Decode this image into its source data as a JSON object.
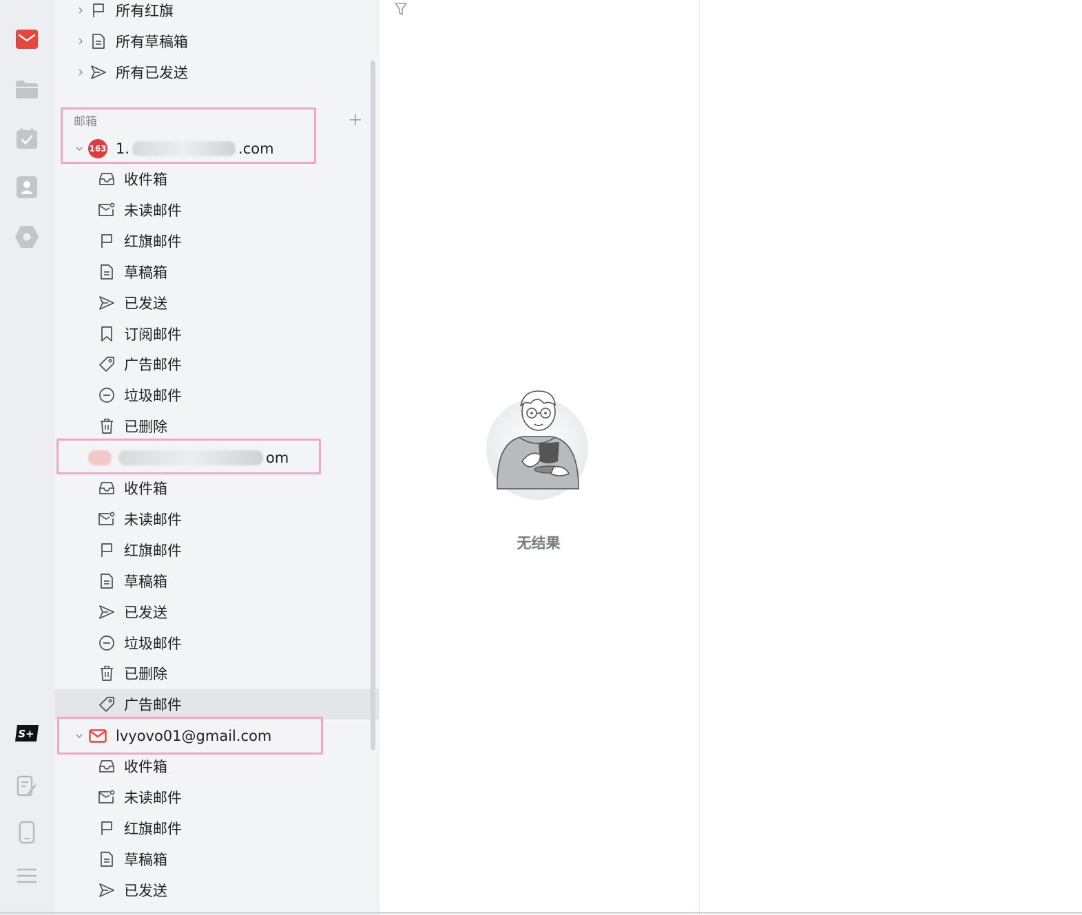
{
  "rail": {
    "top_icons": [
      "mail-icon",
      "folder-icon",
      "calendar-icon",
      "contacts-icon",
      "settings-hex-icon"
    ],
    "bottom_icons": [
      "splus-icon",
      "notes-icon",
      "mobile-icon",
      "menu-icon"
    ],
    "splus_label": "S+"
  },
  "aggregate": {
    "items": [
      {
        "label": "所有红旗",
        "icon": "flag-icon"
      },
      {
        "label": "所有草稿箱",
        "icon": "draft-icon"
      },
      {
        "label": "所有已发送",
        "icon": "send-icon"
      }
    ]
  },
  "mailboxes": {
    "section_label": "邮箱",
    "accounts": [
      {
        "address_prefix": "1.",
        "address_suffix": ".com",
        "badge": "163",
        "folders": [
          {
            "label": "收件箱",
            "icon": "inbox-icon"
          },
          {
            "label": "未读邮件",
            "icon": "unread-icon"
          },
          {
            "label": "红旗邮件",
            "icon": "flag-icon"
          },
          {
            "label": "草稿箱",
            "icon": "draft-icon"
          },
          {
            "label": "已发送",
            "icon": "send-icon"
          },
          {
            "label": "订阅邮件",
            "icon": "bookmark-icon"
          },
          {
            "label": "广告邮件",
            "icon": "tag-icon"
          },
          {
            "label": "垃圾邮件",
            "icon": "spam-icon"
          },
          {
            "label": "已删除",
            "icon": "trash-icon"
          }
        ]
      },
      {
        "address_prefix": "",
        "address_suffix": "om",
        "folders": [
          {
            "label": "收件箱",
            "icon": "inbox-icon"
          },
          {
            "label": "未读邮件",
            "icon": "unread-icon"
          },
          {
            "label": "红旗邮件",
            "icon": "flag-icon"
          },
          {
            "label": "草稿箱",
            "icon": "draft-icon"
          },
          {
            "label": "已发送",
            "icon": "send-icon"
          },
          {
            "label": "垃圾邮件",
            "icon": "spam-icon"
          },
          {
            "label": "已删除",
            "icon": "trash-icon"
          },
          {
            "label": "广告邮件",
            "icon": "tag-icon",
            "selected": true
          }
        ]
      },
      {
        "address": "lvyovo01@gmail.com",
        "folders": [
          {
            "label": "收件箱",
            "icon": "inbox-icon"
          },
          {
            "label": "未读邮件",
            "icon": "unread-icon"
          },
          {
            "label": "红旗邮件",
            "icon": "flag-icon"
          },
          {
            "label": "草稿箱",
            "icon": "draft-icon"
          },
          {
            "label": "已发送",
            "icon": "send-icon"
          }
        ]
      }
    ]
  },
  "main": {
    "empty_text": "无结果"
  },
  "colors": {
    "accent_red": "#e8453c",
    "highlight_box": "#f4a6c6",
    "rail_bg": "#eceef1",
    "panel_bg": "#f3f4f6"
  }
}
